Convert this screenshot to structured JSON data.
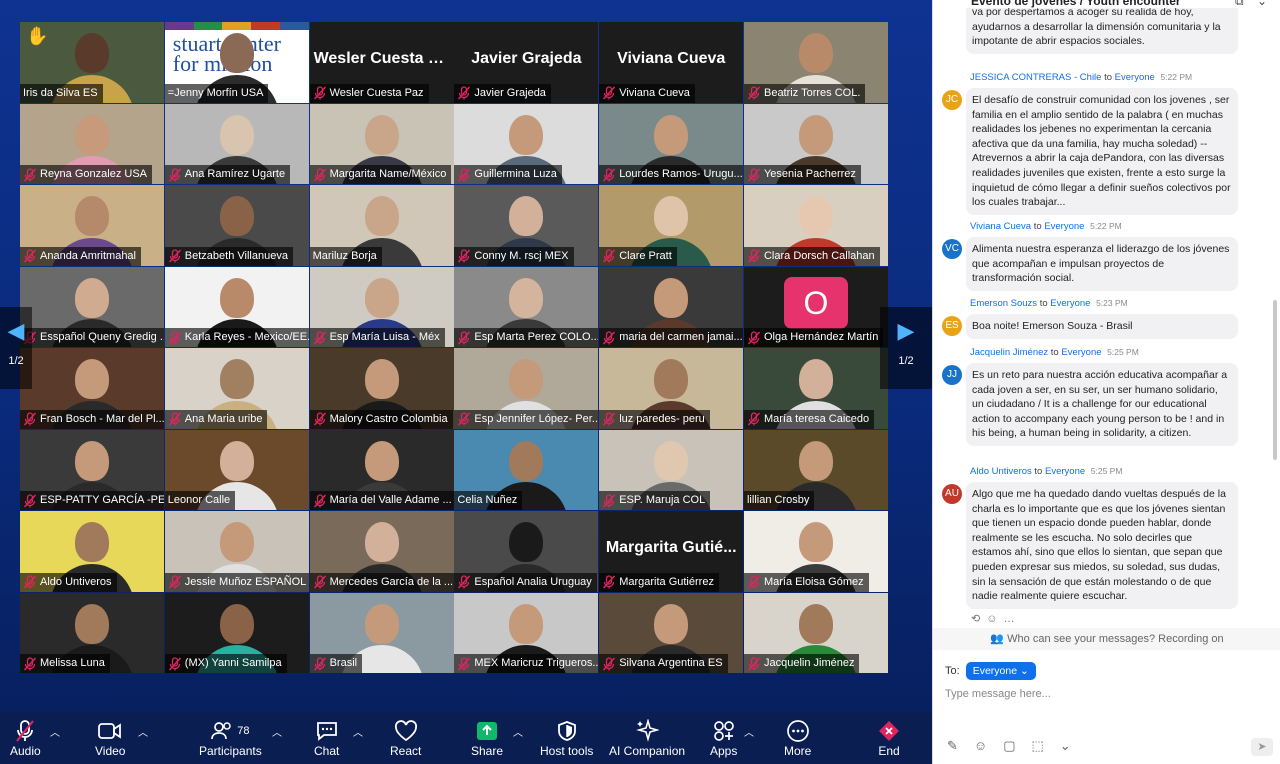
{
  "chat": {
    "title": "Evento de jóvenes / Youth encounter",
    "messages": [
      {
        "sender": "",
        "initials": "",
        "to": "",
        "recipient": "",
        "time": "",
        "text": "va por  despertamos a acoger su realida de hoy, ayudarnos a desarrollar la dimensión comunitaria y la impotante de abrir espacios sociales."
      },
      {
        "sender": "JESSICA CONTRERAS - Chile",
        "initials": "JC",
        "to": "to",
        "recipient": "Everyone",
        "time": "5:22 PM",
        "text": "El desafío de construir comunidad con los jovenes , ser familia en el amplio sentido de la palabra ( en muchas realidades los jebenes no experimentan la cercania afectiva que da una familia, hay mucha soledad) -- Atrevernos a abrir la caja dePandora, con las diversas  realidades juveniles que existen, frente a esto surge la inquietud de cómo llegar a definir sueños colectivos por los cuales trabajar..."
      },
      {
        "sender": "Viviana Cueva",
        "initials": "VC",
        "to": "to",
        "recipient": "Everyone",
        "time": "5:22 PM",
        "text": "Alimenta nuestra esperanza el liderazgo de los jóvenes que acompañan e impulsan proyectos de transformación social."
      },
      {
        "sender": "Emerson Souzs",
        "initials": "ES",
        "to": "to",
        "recipient": "Everyone",
        "time": "5:23 PM",
        "text": "Boa noite! Emerson Souza - Brasil"
      },
      {
        "sender": "Jacquelin Jiménez",
        "initials": "JJ",
        "to": "to",
        "recipient": "Everyone",
        "time": "5:25 PM",
        "text": "Es un reto para nuestra acción educativa acompañar a cada joven a ser, en su ser, un ser humano solidario, un ciudadano / It is a challenge for our educational action to accompany each young person to be ! and in his being, a human being in solidarity, a citizen."
      },
      {
        "sender": "Aldo Untiveros",
        "initials": "AU",
        "to": "to",
        "recipient": "Everyone",
        "time": "5:25 PM",
        "text": "Algo que me ha quedado dando vueltas después de la charla es lo importante que es que los jóvenes sientan que tienen un espacio donde pueden hablar, donde realmente se les escucha. No solo decirles que estamos ahí, sino que ellos lo sientan, que sepan que pueden expresar sus miedos, su soledad, sus dudas, sin la sensación de que están molestando o de que nadie realmente quiere escuchar."
      }
    ],
    "privacy_notice": "Who can see your messages? Recording on",
    "to_label": "To:",
    "to_value": "Everyone",
    "input_placeholder": "Type message here..."
  },
  "page_indicator": "1/2",
  "logo_text": "stuart center for mission",
  "tiles": [
    {
      "name": "Iris da Silva ES",
      "muted": false,
      "hand": true,
      "active": true,
      "bg": "#4b5a3f",
      "skin": "#5a3a2a",
      "shirt": "#c9a34a"
    },
    {
      "name": "=Jenny Morfín USA",
      "muted": false,
      "logo": true,
      "bg": "#ffffff",
      "skin": "#8a6a55",
      "shirt": "#2c2c2c"
    },
    {
      "name": "Wesler Cuesta Paz",
      "muted": true,
      "big": "Wesler Cuesta Paz",
      "bg": "#1c1c1c"
    },
    {
      "name": "Javier Grajeda",
      "muted": true,
      "big": "Javier Grajeda",
      "bg": "#1c1c1c"
    },
    {
      "name": "Viviana Cueva",
      "muted": true,
      "big": "Viviana Cueva",
      "bg": "#1c1c1c"
    },
    {
      "name": "Beatriz Torres COL.",
      "muted": true,
      "bg": "#8b8470",
      "skin": "#b88a6a",
      "shirt": "#e6e0d6"
    },
    {
      "name": "Reyna Gonzalez USA",
      "muted": true,
      "bg": "#b5a48c",
      "skin": "#c69a7a",
      "shirt": "#e29bb0"
    },
    {
      "name": "Ana Ramírez Ugarte",
      "muted": true,
      "bg": "#b8b8b8",
      "skin": "#d9c4b0",
      "shirt": "#3a3a3a"
    },
    {
      "name": "Margarita Name/México",
      "muted": true,
      "bg": "#c9c3b5",
      "skin": "#c9a58a",
      "shirt": "#3a3a46"
    },
    {
      "name": "Guillermina Luza",
      "muted": true,
      "bg": "#dcdcdc",
      "skin": "#c49a7a",
      "shirt": "#5a6a7a"
    },
    {
      "name": "Lourdes Ramos- Urugu...",
      "muted": true,
      "bg": "#7a8a8a",
      "skin": "#c49a7a",
      "shirt": "#2a2a2a"
    },
    {
      "name": "Yesenia Pacherrez",
      "muted": true,
      "bg": "#c9c9c9",
      "skin": "#c49a7a",
      "shirt": "#4a3a2a"
    },
    {
      "name": "Ananda Amritmahal",
      "muted": true,
      "bg": "#c9b087",
      "skin": "#b48a6a",
      "shirt": "#6a4a8a"
    },
    {
      "name": "Betzabeth Villanueva",
      "muted": true,
      "bg": "#4a4a4a",
      "skin": "#8a6248",
      "shirt": "#2a2a2a"
    },
    {
      "name": "Mariluz Borja",
      "muted": false,
      "bg": "#d0c7b8",
      "skin": "#c9a58a",
      "shirt": "#3a3a3a"
    },
    {
      "name": "Conny M. rscj MEX",
      "muted": true,
      "bg": "#5a5a5a",
      "skin": "#d2b09a",
      "shirt": "#2e3a4a"
    },
    {
      "name": "Clare Pratt",
      "muted": true,
      "bg": "#b29a6a",
      "skin": "#e0c4aa",
      "shirt": "#2a5a4a"
    },
    {
      "name": "Clara Dorsch Callahan",
      "muted": true,
      "bg": "#d8cfc0",
      "skin": "#e6c8b0",
      "shirt": "#c0392b"
    },
    {
      "name": "Esspañol Queny Gredig ...",
      "muted": true,
      "bg": "#6a6a6a",
      "skin": "#d0ab90",
      "shirt": "#2a2a2a"
    },
    {
      "name": "Karla Reyes - Mexico/EE...",
      "muted": true,
      "bg": "#f2f2f2",
      "skin": "#b88a6a",
      "shirt": "#1a1a1a"
    },
    {
      "name": "Esp María Luisa - Méx",
      "muted": true,
      "bg": "#d0cbc2",
      "skin": "#c9a58a",
      "shirt": "#2a3a8a"
    },
    {
      "name": "Esp Marta Perez COLO...",
      "muted": true,
      "bg": "#8a8a8a",
      "skin": "#d4b49c",
      "shirt": "#3a3a3a"
    },
    {
      "name": "maria del carmen jamai...",
      "muted": true,
      "bg": "#3a3a3a",
      "skin": "#c49a7a",
      "shirt": "#5a3a2a"
    },
    {
      "name": "Olga Hernández Martín",
      "muted": true,
      "avatar": "O",
      "bg": "#1c1c1c"
    },
    {
      "name": "Fran Bosch - Mar del Pl...",
      "muted": true,
      "bg": "#5a3a2a",
      "skin": "#c49a7a",
      "shirt": "#2a2a2a"
    },
    {
      "name": "Ana Maria uribe",
      "muted": true,
      "bg": "#d8d2c8",
      "skin": "#a08060",
      "shirt": "#c8b080"
    },
    {
      "name": "Malory Castro Colombia",
      "muted": true,
      "bg": "#4a3a2a",
      "skin": "#c49a7a",
      "shirt": "#1a1a1a"
    },
    {
      "name": "Esp Jennifer López- Per...",
      "muted": true,
      "bg": "#b0a898",
      "skin": "#c49a7a",
      "shirt": "#e0e0e0"
    },
    {
      "name": "luz paredes-  peru",
      "muted": true,
      "bg": "#c8b89a",
      "skin": "#a07a5a",
      "shirt": "#5a3a2a"
    },
    {
      "name": "María teresa Caicedo",
      "muted": true,
      "bg": "#3a4a3a",
      "skin": "#d2b09a",
      "shirt": "#e0e0e0"
    },
    {
      "name": "ESP-PATTY GARCÍA -PER...",
      "muted": true,
      "bg": "#3a3a3a",
      "skin": "#c49a7a",
      "shirt": "#2a2a2a"
    },
    {
      "name": "Leonor Calle",
      "muted": false,
      "bg": "#6a4a2a",
      "skin": "#d2b09a",
      "shirt": "#e6e6e6"
    },
    {
      "name": "María del Valle Adame ...",
      "muted": true,
      "bg": "#2a2a2a",
      "skin": "#c49a7a",
      "shirt": "#3a3a3a"
    },
    {
      "name": "Celia Nuñez",
      "muted": false,
      "bg": "#4a8ab0",
      "skin": "#a07a5a",
      "shirt": "#1a1a1a"
    },
    {
      "name": "ESP. Maruja COL",
      "muted": true,
      "bg": "#c8c2b8",
      "skin": "#e0c8b0",
      "shirt": "#6a6a6a"
    },
    {
      "name": "lillian Crosby",
      "muted": false,
      "bg": "#5a4a2a",
      "skin": "#c49a7a",
      "shirt": "#2a2a2a"
    },
    {
      "name": "Aldo Untiveros",
      "muted": true,
      "bg": "#e8d85a",
      "skin": "#a07a5a",
      "shirt": "#2a2a2a"
    },
    {
      "name": "Jessie Muñoz ESPAÑOL",
      "muted": true,
      "bg": "#c8c2b8",
      "skin": "#c49a7a",
      "shirt": "#e0e0e0"
    },
    {
      "name": "Mercedes García de la ...",
      "muted": true,
      "bg": "#7a6a5a",
      "skin": "#d2b09a",
      "shirt": "#2a2a2a"
    },
    {
      "name": "Español Analia Uruguay",
      "muted": true,
      "bg": "#4a4a4a",
      "skin": "#1a1a1a",
      "shirt": "#2a2a2a"
    },
    {
      "name": "Margarita Gutiérrez",
      "muted": true,
      "big": "Margarita  Gutié...",
      "bg": "#1c1c1c"
    },
    {
      "name": "María Eloisa Gómez",
      "muted": true,
      "bg": "#f0ece6",
      "skin": "#c49a7a",
      "shirt": "#3a3a3a"
    },
    {
      "name": "Melissa Luna",
      "muted": true,
      "bg": "#2a2a2a",
      "skin": "#a07a5a",
      "shirt": "#1a1a1a"
    },
    {
      "name": "(MX) Yanni Samilpa",
      "muted": true,
      "bg": "#1c1c1c",
      "skin": "#8a6248",
      "shirt": "#2ab0a0"
    },
    {
      "name": "Brasil",
      "muted": true,
      "bg": "#8a9aa0",
      "skin": "#c49a7a",
      "shirt": "#e6e6e6"
    },
    {
      "name": "MEX Maricruz Trigueros...",
      "muted": true,
      "bg": "#c8c8c8",
      "skin": "#c49a7a",
      "shirt": "#1a1a1a"
    },
    {
      "name": "Silvana Argentina ES",
      "muted": true,
      "bg": "#5a4a3a",
      "skin": "#c49a7a",
      "shirt": "#2a2a2a"
    },
    {
      "name": "Jacquelin Jiménez",
      "muted": true,
      "bg": "#d8d4cc",
      "skin": "#a07a5a",
      "shirt": "#2a8a3a"
    }
  ],
  "toolbar": {
    "audio": "Audio",
    "video": "Video",
    "participants": "Participants",
    "participants_count": "78",
    "chat": "Chat",
    "react": "React",
    "share": "Share",
    "host_tools": "Host tools",
    "ai_companion": "AI Companion",
    "apps": "Apps",
    "more": "More",
    "end": "End"
  },
  "colors": {
    "accent": "#0e71eb",
    "share_green": "#10b96a",
    "end_pink": "#e0245e",
    "active_speaker": "#5fe08a"
  }
}
